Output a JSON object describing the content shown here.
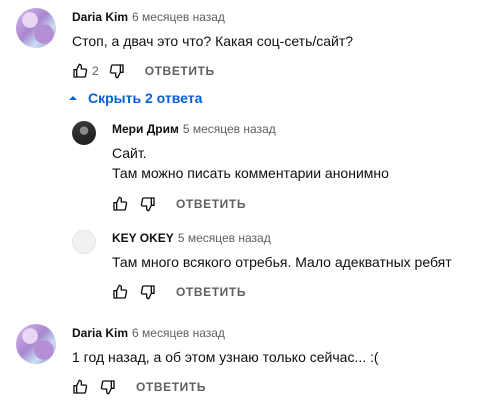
{
  "comments": [
    {
      "author": "Daria Kim",
      "time": "6 месяцев назад",
      "lines": [
        "Стоп, а двач это что? Какая соц-сеть/сайт?"
      ],
      "likes": "2",
      "reply_label": "ОТВЕТИТЬ",
      "toggle_label": "Скрыть 2 ответа"
    },
    {
      "author": "Мери Дрим",
      "time": "5 месяцев назад",
      "lines": [
        "Сайт.",
        "Там можно писать комментарии анонимно"
      ],
      "reply_label": "ОТВЕТИТЬ"
    },
    {
      "author": "KEY OKEY",
      "time": "5 месяцев назад",
      "lines": [
        "Там много всякого отребья. Мало адекватных ребят"
      ],
      "reply_label": "ОТВЕТИТЬ"
    },
    {
      "author": "Daria Kim",
      "time": "6 месяцев назад",
      "lines": [
        "1 год назад, а об этом узнаю только сейчас... :("
      ],
      "reply_label": "ОТВЕТИТЬ"
    }
  ],
  "icons": {
    "like": "thumb-up-icon",
    "dislike": "thumb-down-icon",
    "toggle": "chevron-up-icon"
  },
  "colors": {
    "link": "#065fd4",
    "secondary_text": "#606060"
  }
}
